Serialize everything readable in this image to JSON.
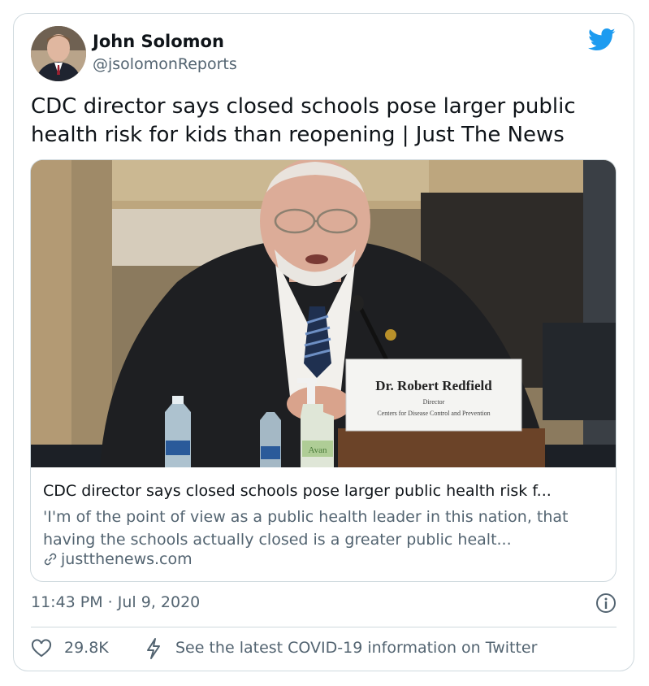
{
  "author": {
    "name": "John Solomon",
    "handle": "@jsolomonReports"
  },
  "tweet": {
    "text": "CDC director says closed schools pose larger public health risk for kids than reopening | Just The News",
    "timestamp": "11:43 PM · Jul 9, 2020",
    "likes": "29.8K",
    "covid_notice": "See the latest COVID-19 information on Twitter"
  },
  "link_card": {
    "image": {
      "nameplate_name": "Dr. Robert Redfield",
      "nameplate_title": "Director",
      "nameplate_org": "Centers for Disease Control and Prevention",
      "bottle_label": "Avan"
    },
    "title": "CDC director says closed schools pose larger public health risk f...",
    "description": "'I'm of the point of view as a public health leader in this nation, that having the schools actually closed is a greater public healt...",
    "domain": "justthenews.com"
  },
  "colors": {
    "twitter_blue": "#1d9bf0",
    "text_primary": "#0f1419",
    "text_secondary": "#536471",
    "border": "#cfd9de"
  },
  "icons": [
    "twitter-bird-icon",
    "link-icon",
    "info-icon",
    "heart-icon",
    "bolt-icon"
  ]
}
